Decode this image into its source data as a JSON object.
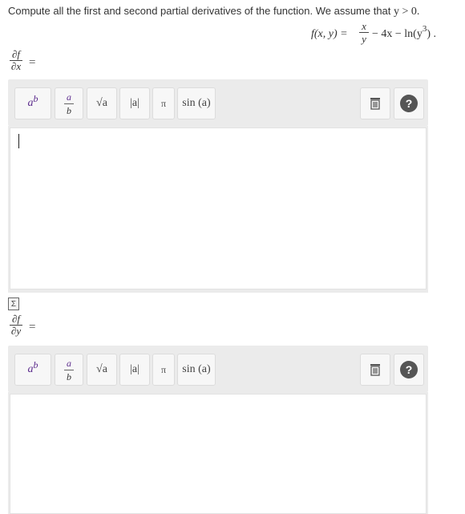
{
  "prompt": {
    "text": "Compute all the first and second partial derivatives of the function. We assume that",
    "condition": "y > 0."
  },
  "function": {
    "lhs": "f(x, y) =",
    "frac_num": "x",
    "frac_den": "y",
    "rest_a": "− 4x − ln(y",
    "exponent": "3",
    "rest_b": ") ."
  },
  "answers": [
    {
      "partial_num": "∂f",
      "partial_den": "∂x",
      "equals": "="
    },
    {
      "partial_num": "∂f",
      "partial_den": "∂y",
      "equals": "="
    }
  ],
  "toolbar": {
    "power_base": "a",
    "power_exp": "b",
    "fraction_num": "a",
    "fraction_den": "b",
    "sqrt_label": "√a",
    "abs_label": "|a|",
    "pi_label": "π",
    "sin_label": "sin (a)",
    "trash_icon": "trash-icon",
    "help_label": "?"
  },
  "sigma_label": "Σ"
}
